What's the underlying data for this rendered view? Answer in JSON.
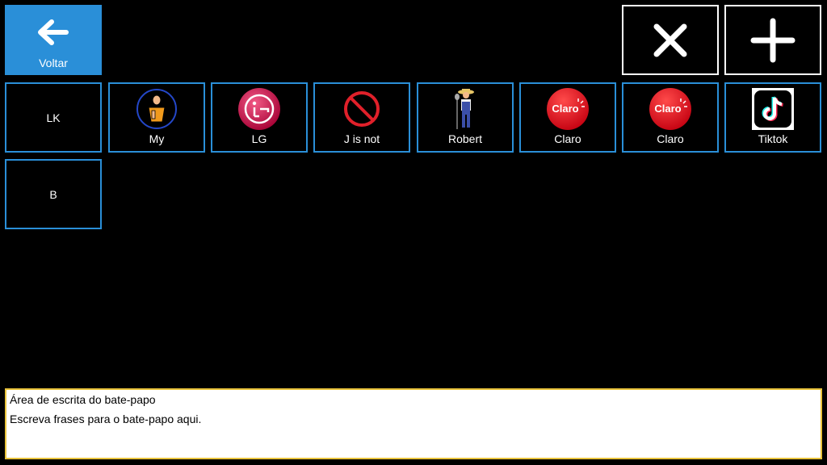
{
  "toolbar": {
    "back_label": "Voltar",
    "close_icon": "close-icon",
    "add_icon": "plus-icon"
  },
  "tiles": [
    {
      "label": "LK",
      "icon": null
    },
    {
      "label": "My",
      "icon": "person-pointing-self-icon"
    },
    {
      "label": "LG",
      "icon": "lg-logo-icon"
    },
    {
      "label": "J is not",
      "icon": "prohibited-icon"
    },
    {
      "label": "Robert",
      "icon": "farmer-person-icon"
    },
    {
      "label": "Claro",
      "icon": "claro-logo-icon"
    },
    {
      "label": "Claro",
      "icon": "claro-logo-icon"
    },
    {
      "label": "Tiktok",
      "icon": "tiktok-logo-icon"
    },
    {
      "label": "B",
      "icon": null
    }
  ],
  "chat": {
    "title": "Área de escrita do bate-papo",
    "text": "Escreva frases para o bate-papo aqui."
  },
  "colors": {
    "accent": "#2a8fd8",
    "chat_border": "#e8c23a",
    "background": "#000000"
  }
}
